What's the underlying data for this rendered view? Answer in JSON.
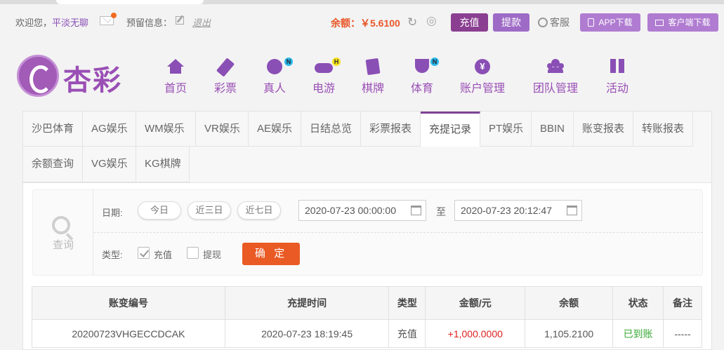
{
  "topbar": {
    "welcome": "欢迎您，",
    "username": "平淡无聊",
    "reserved_label": "预留信息：",
    "logout": "退出",
    "balance_label": "余额：",
    "balance_value": "￥5.6100",
    "charge": "充值",
    "withdraw": "提款",
    "service": "客服",
    "app_download": "APP下载",
    "client_download": "客户端下载"
  },
  "logo": {
    "text": "杏彩"
  },
  "nav": [
    {
      "label": "首页",
      "icon": "home-icon",
      "badge": ""
    },
    {
      "label": "彩票",
      "icon": "ticket-icon",
      "badge": ""
    },
    {
      "label": "真人",
      "icon": "live-dealer-icon",
      "badge": "N"
    },
    {
      "label": "电游",
      "icon": "gamepad-icon",
      "badge": "H"
    },
    {
      "label": "棋牌",
      "icon": "cards-icon",
      "badge": ""
    },
    {
      "label": "体育",
      "icon": "trophy-icon",
      "badge": "N"
    },
    {
      "label": "账户管理",
      "icon": "yen-coin-icon",
      "badge": ""
    },
    {
      "label": "团队管理",
      "icon": "team-icon",
      "badge": ""
    },
    {
      "label": "活动",
      "icon": "gift-icon",
      "badge": ""
    }
  ],
  "tabs": [
    "沙巴体育",
    "AG娱乐",
    "WM娱乐",
    "VR娱乐",
    "AE娱乐",
    "日结总览",
    "彩票报表",
    "充提记录",
    "PT娱乐",
    "BBIN",
    "账变报表",
    "转账报表",
    "余额查询",
    "VG娱乐",
    "KG棋牌"
  ],
  "active_tab": "充提记录",
  "query": {
    "title": "查询",
    "date_label": "日期:",
    "today": "今日",
    "three_days": "近三日",
    "seven_days": "近七日",
    "start_date": "2020-07-23 00:00:00",
    "to": "至",
    "end_date": "2020-07-23 20:12:47",
    "type_label": "类型:",
    "type_charge": "充值",
    "type_withdraw": "提现",
    "confirm": "确 定"
  },
  "table": {
    "headers": [
      "账变编号",
      "充提时间",
      "类型",
      "金额/元",
      "余额",
      "状态",
      "备注"
    ],
    "rows": [
      [
        "20200723VHGECCDCAK",
        "2020-07-23 18:19:45",
        "充值",
        "+1,000.0000",
        "1,105.2100",
        "已到账",
        "-----"
      ]
    ]
  },
  "colors": {
    "brand": "#8a4fb5",
    "accent": "#ea5a24",
    "success": "#35a832",
    "amount": "#e02020"
  }
}
